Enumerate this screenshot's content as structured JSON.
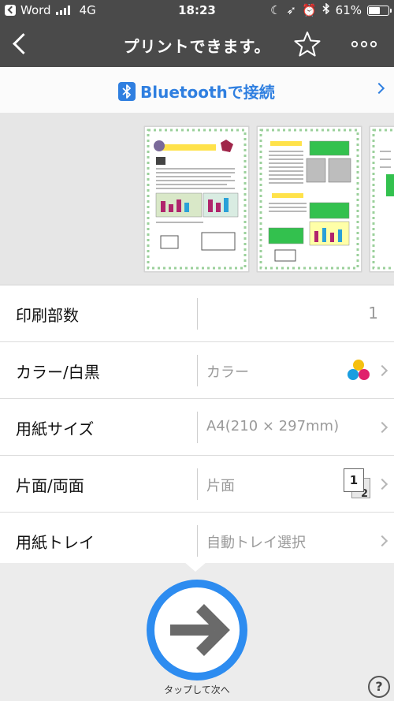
{
  "status_bar": {
    "carrier": "Word",
    "network": "4G",
    "time": "18:23",
    "battery": "61%",
    "battery_level": 0.61
  },
  "nav": {
    "title": "プリントできます。"
  },
  "bluetooth": {
    "label": "Bluetoothで接続"
  },
  "settings": {
    "copies": {
      "label": "印刷部数",
      "value": "1"
    },
    "color": {
      "label": "カラー/白黒",
      "value": "カラー"
    },
    "paper_size": {
      "label": "用紙サイズ",
      "value": "A4(210 × 297mm)"
    },
    "duplex": {
      "label": "片面/両面",
      "value": "片面",
      "icon_front": "1",
      "icon_back": "2"
    },
    "tray": {
      "label": "用紙トレイ",
      "value": "自動トレイ選択"
    }
  },
  "next": {
    "label": "タップして次へ"
  },
  "help": "?",
  "colors": {
    "accent": "#2d8cf0",
    "bluetooth": "#2f7fe0",
    "bar": "#4a4a4a"
  }
}
